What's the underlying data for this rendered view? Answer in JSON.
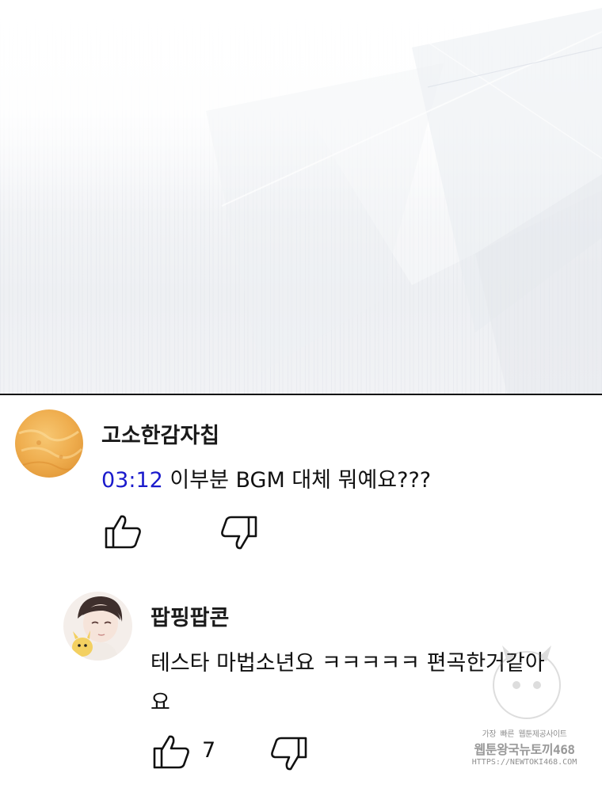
{
  "comments": [
    {
      "author": "고소한감자칩",
      "timestamp": "03:12",
      "text": " 이부분 BGM 대체 뭐예요???",
      "like_icon": "thumbs-up-outline",
      "dislike_icon": "thumbs-down-outline",
      "replies": [
        {
          "author": "팝핑팝콘",
          "text_line1": "테스타 마법소년요 ㅋㅋㅋㅋㅋ 편곡한거같아",
          "text_line2": "요",
          "like_count": "7",
          "like_icon": "thumbs-up-outline",
          "dislike_icon": "thumbs-down-outline"
        }
      ]
    }
  ],
  "watermark": {
    "line1": "가장 빠른 웹툰제공사이트",
    "line2": "웹툰왕국뉴토끼468",
    "line3": "HTTPS://NEWTOKI468.COM"
  },
  "colors": {
    "timestamp_link": "#1a1acc",
    "divider": "#111111",
    "avatar1": "#f0b455"
  }
}
